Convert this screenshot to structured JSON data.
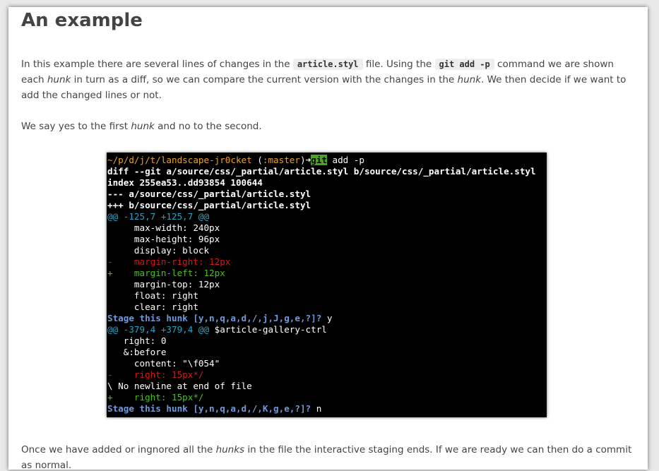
{
  "article": {
    "heading": "An example",
    "p1": {
      "t1": "In this example there are several lines of changes in the ",
      "code1": "article.styl",
      "t2": " file. Using the ",
      "code2": "git add -p",
      "t3": " command we are shown each ",
      "em1": "hunk",
      "t4": " in turn as a diff, so we can compare the current version with the changes in the ",
      "em2": "hunk",
      "t5": ". We then decide if we want to add the changed lines or not."
    },
    "p2": {
      "t1": "We say yes to the first ",
      "em1": "hunk",
      "t2": " and no to the second."
    },
    "p3": {
      "t1": "Once we have added or ingnored all the ",
      "em1": "hunks",
      "t2": " in the file the interactive staging ends. If we are ready we can then do a commit as normal."
    }
  },
  "terminal": {
    "prompt_path": "~/p/d/j/t/landscape-jr0cket",
    "prompt_branch_open": " (",
    "prompt_branch": ":master",
    "prompt_branch_close": ")",
    "prompt_arrow": "➜",
    "cmd_git": "git",
    "cmd_rest": " add -p",
    "diff_header": "diff --git a/source/css/_partial/article.styl b/source/css/_partial/article.styl",
    "index_line": "index 255ea53..dd93854 100644",
    "minus_file": "--- a/source/css/_partial/article.styl",
    "plus_file": "+++ b/source/css/_partial/article.styl",
    "hunk1_header": "@@ -125,7 +125,7 @@",
    "h1_l1": "     max-width: 240px",
    "h1_l2": "     max-height: 96px",
    "h1_l3": "     display: block",
    "h1_removed": "-    margin-right: 12px",
    "h1_added": "+    margin-left: 12px",
    "h1_l4": "     margin-top: 12px",
    "h1_l5": "     float: right",
    "h1_l6": "     clear: right",
    "stage1_prompt": "Stage this hunk [y,n,q,a,d,/,j,J,g,e,?]?",
    "stage1_answer": " y",
    "hunk2_header": "@@ -379,4 +379,4 @@",
    "hunk2_context": " $article-gallery-ctrl",
    "h2_l1": "   right: 0",
    "h2_l2": "   &:before",
    "h2_l3": "     content: \"\\f054\"",
    "h2_removed": "-    right: 15px*/",
    "no_newline": "\\ No newline at end of file",
    "h2_added": "+    right: 15px*/",
    "stage2_prompt": "Stage this hunk [y,n,q,a,d,/,K,g,e,?]?",
    "stage2_answer": " n"
  },
  "colors": {
    "terminal_bg": "#000000",
    "hunk_header": "#21a6c9",
    "stage_prompt": "#6f9ad9",
    "removed": "#d21a1a",
    "added": "#4fbf1f",
    "prompt_path": "#e7a325",
    "git_highlight": "#49a520"
  }
}
